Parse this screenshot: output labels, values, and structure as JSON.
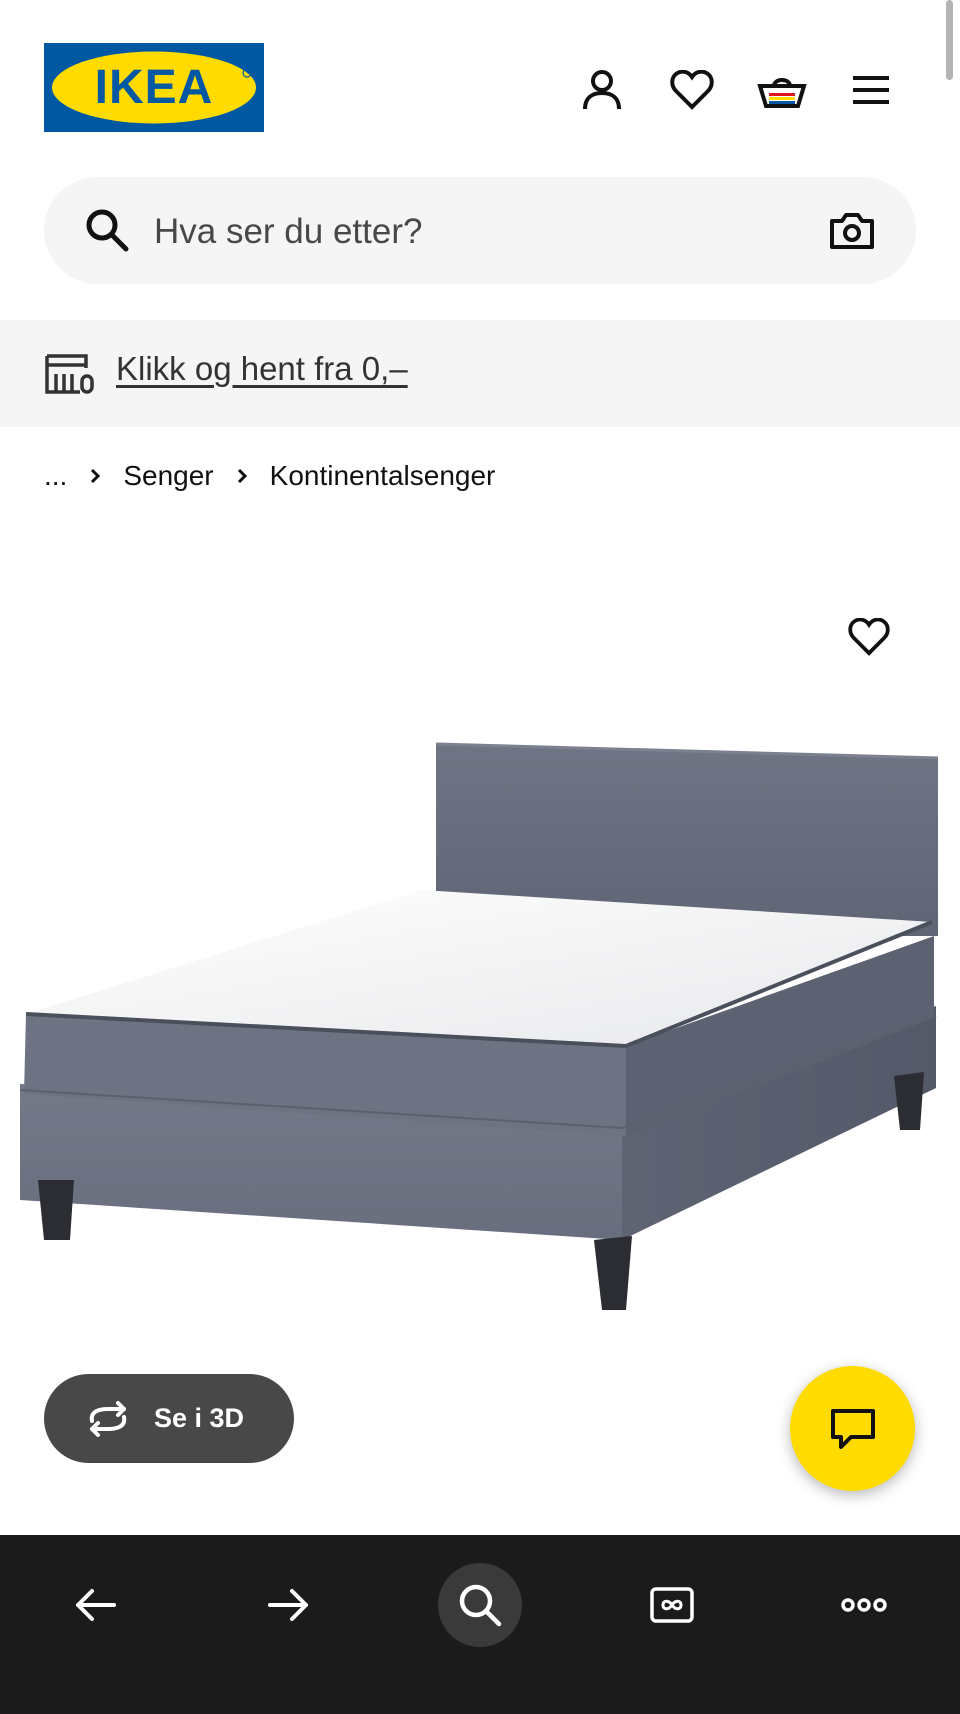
{
  "header": {
    "logo_text": "IKEA",
    "icons": [
      "account-icon",
      "wishlist-icon",
      "cart-icon",
      "menu-icon"
    ]
  },
  "search": {
    "placeholder": "Hva ser du etter?"
  },
  "banner": {
    "link_text": "Klikk og hent fra 0,–"
  },
  "breadcrumb": {
    "ellipsis": "...",
    "items": [
      "Senger",
      "Kontinentalsenger"
    ]
  },
  "product": {
    "view_3d_label": "Se i 3D"
  },
  "browser_bar": {
    "icons": [
      "back-arrow-icon",
      "forward-arrow-icon",
      "search-icon",
      "tabs-icon",
      "more-icon"
    ]
  },
  "colors": {
    "ikea_blue": "#0058a3",
    "ikea_yellow": "#ffdb00",
    "panel_grey": "#f5f5f5",
    "button_dark": "#484848",
    "browser_bar": "#1b1b1b"
  }
}
